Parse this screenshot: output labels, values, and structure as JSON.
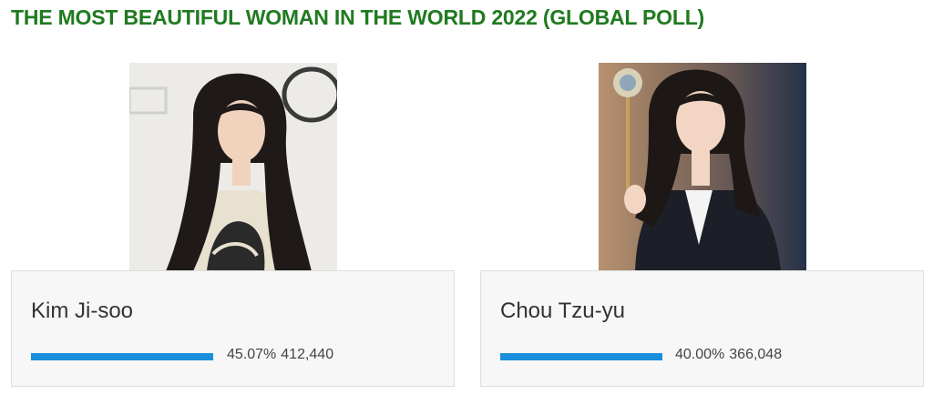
{
  "poll": {
    "title": "THE MOST BEAUTIFUL WOMAN IN THE WORLD 2022 (GLOBAL POLL)",
    "title_color": "#1f7a1f",
    "bar_color": "#1a90dd",
    "candidates": [
      {
        "name": "Kim Ji-soo",
        "percent_label": "45.07%",
        "votes": "412,440",
        "share": 0.4507
      },
      {
        "name": "Chou Tzu-yu",
        "percent_label": "40.00%",
        "votes": "366,048",
        "share": 0.4
      }
    ]
  }
}
